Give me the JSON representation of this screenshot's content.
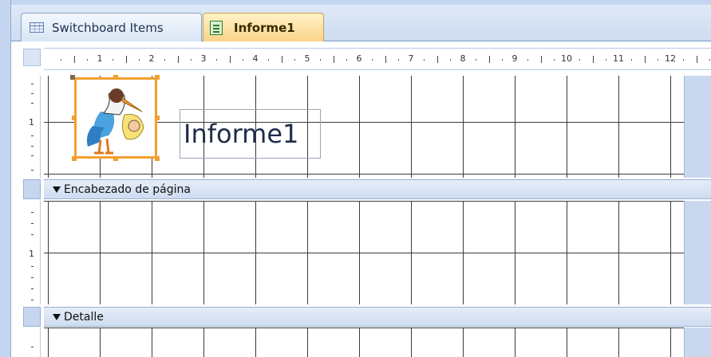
{
  "tabs": [
    {
      "label": "Switchboard Items",
      "icon": "table-icon",
      "active": false
    },
    {
      "label": "Informe1",
      "icon": "report-icon",
      "active": true
    }
  ],
  "ruler": {
    "labels": [
      "1",
      "2",
      "3",
      "4",
      "5",
      "6",
      "7",
      "8",
      "9",
      "10",
      "11",
      "12"
    ]
  },
  "vertical_ruler": {
    "label": "1"
  },
  "report": {
    "title_control": "Informe1",
    "logo_icon": "stork-baby-icon"
  },
  "sections": {
    "page_header": "Encabezado de página",
    "detail": "Detalle"
  },
  "colors": {
    "accent": "#f0a030",
    "grid": "#3b3b3b",
    "section_bar": "#dce6f5"
  }
}
